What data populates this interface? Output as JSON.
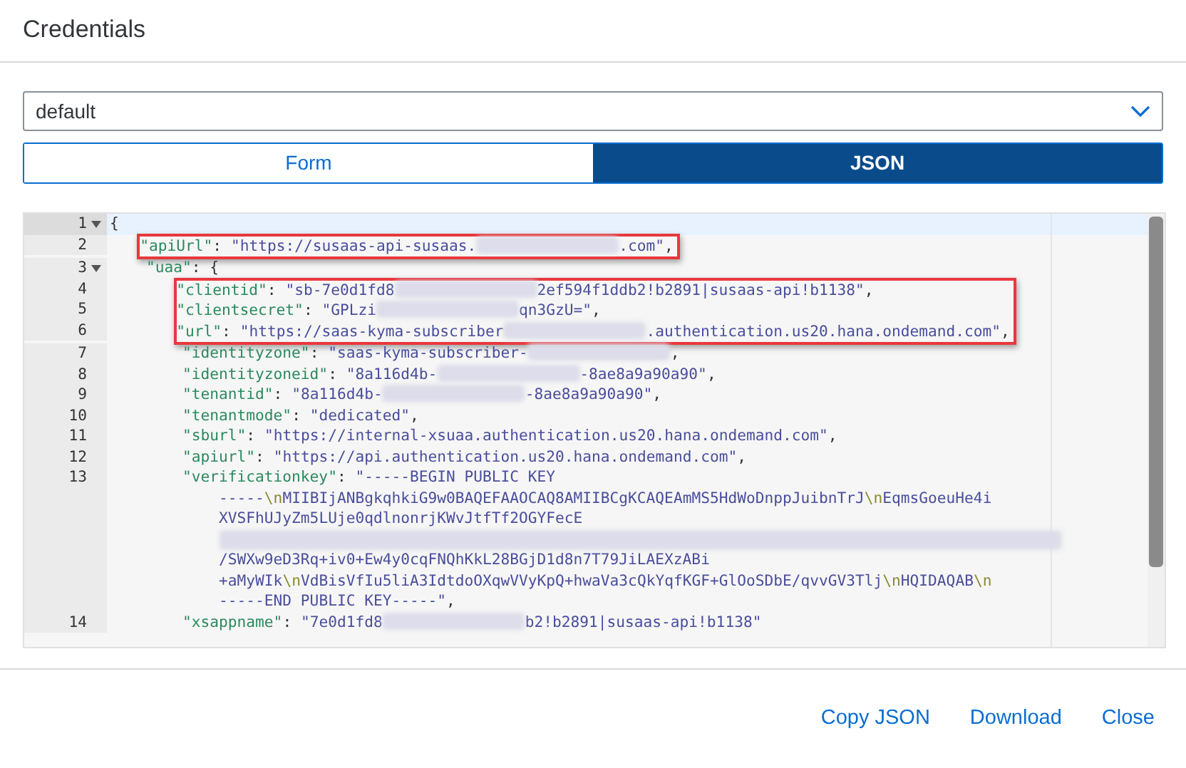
{
  "dialog": {
    "title": "Credentials"
  },
  "select": {
    "value": "default"
  },
  "view_tabs": [
    {
      "label": "Form",
      "selected": false
    },
    {
      "label": "JSON",
      "selected": true
    }
  ],
  "editor": {
    "lines": [
      {
        "number": "1",
        "active": true,
        "boxed": false,
        "segments": [
          {
            "kind": "punct",
            "text": "{"
          }
        ],
        "children": [
          {
            "number": "2",
            "active": false,
            "boxed": true,
            "segments": [
              {
                "kind": "key",
                "text": "\"apiUrl\""
              },
              {
                "kind": "punct",
                "text": ":"
              },
              {
                "kind": "str",
                "text": "\"https://susaas-api-susaas."
              },
              {
                "kind": "blur"
              },
              {
                "kind": "str",
                "text": ".com\""
              },
              {
                "kind": "punct",
                "text": ","
              }
            ]
          },
          {
            "number": "3",
            "active": false,
            "boxed": false,
            "segments": [
              {
                "kind": "key",
                "text": "\"uaa\""
              },
              {
                "kind": "punct",
                "text": ": {"
              }
            ],
            "children": [
              {
                "number": "4",
                "active": false,
                "boxed": true,
                "segments": [
                  {
                    "kind": "key",
                    "text": "\"clientid\""
                  },
                  {
                    "kind": "punct",
                    "text": ":"
                  },
                  {
                    "kind": "str",
                    "text": "\"sb-7e0d1fd8"
                  },
                  {
                    "kind": "blur"
                  },
                  {
                    "kind": "str",
                    "text": "2ef594f1ddb2!b2891|susaas-api!b1138\""
                  },
                  {
                    "kind": "punct",
                    "text": ","
                  }
                ]
              },
              {
                "number": "5",
                "active": false,
                "boxed": true,
                "segments": [
                  {
                    "kind": "key",
                    "text": "\"clientsecret\""
                  },
                  {
                    "kind": "punct",
                    "text": ":"
                  },
                  {
                    "kind": "str",
                    "text": "\"GPLzi"
                  },
                  {
                    "kind": "blur"
                  },
                  {
                    "kind": "str",
                    "text": "qn3GzU=\""
                  },
                  {
                    "kind": "punct",
                    "text": ","
                  }
                ]
              },
              {
                "number": "6",
                "active": false,
                "boxed": true,
                "segments": [
                  {
                    "kind": "key",
                    "text": "\"url\""
                  },
                  {
                    "kind": "punct",
                    "text": ":"
                  },
                  {
                    "kind": "str",
                    "text": "\"https://saas-kyma-subscriber"
                  },
                  {
                    "kind": "blur"
                  },
                  {
                    "kind": "str",
                    "text": ".authentication.us20.hana.ondemand.com\""
                  },
                  {
                    "kind": "punct",
                    "text": ","
                  }
                ]
              },
              {
                "number": "7",
                "active": false,
                "boxed": false,
                "segments": [
                  {
                    "kind": "key",
                    "text": "\"identityzone\""
                  },
                  {
                    "kind": "punct",
                    "text": ":"
                  },
                  {
                    "kind": "str",
                    "text": "\"saas-kyma-subscriber-"
                  },
                  {
                    "kind": "blur"
                  },
                  {
                    "kind": "punct",
                    "text": ","
                  }
                ]
              },
              {
                "number": "8",
                "active": false,
                "boxed": false,
                "segments": [
                  {
                    "kind": "key",
                    "text": "\"identityzoneid\""
                  },
                  {
                    "kind": "punct",
                    "text": ":"
                  },
                  {
                    "kind": "str",
                    "text": "\"8a116d4b-"
                  },
                  {
                    "kind": "blur"
                  },
                  {
                    "kind": "str",
                    "text": "-8ae8a9a90a90\""
                  },
                  {
                    "kind": "punct",
                    "text": ","
                  }
                ]
              },
              {
                "number": "9",
                "active": false,
                "boxed": false,
                "segments": [
                  {
                    "kind": "key",
                    "text": "\"tenantid\""
                  },
                  {
                    "kind": "punct",
                    "text": ":"
                  },
                  {
                    "kind": "str",
                    "text": "\"8a116d4b-"
                  },
                  {
                    "kind": "blur"
                  },
                  {
                    "kind": "str",
                    "text": "-8ae8a9a90a90\""
                  },
                  {
                    "kind": "punct",
                    "text": ","
                  }
                ]
              },
              {
                "number": "10",
                "active": false,
                "boxed": false,
                "segments": [
                  {
                    "kind": "key",
                    "text": "\"tenantmode\""
                  },
                  {
                    "kind": "punct",
                    "text": ":"
                  },
                  {
                    "kind": "str",
                    "text": "\"dedicated\""
                  },
                  {
                    "kind": "punct",
                    "text": ","
                  }
                ]
              },
              {
                "number": "11",
                "active": false,
                "boxed": false,
                "segments": [
                  {
                    "kind": "key",
                    "text": "\"sburl\""
                  },
                  {
                    "kind": "punct",
                    "text": ":"
                  },
                  {
                    "kind": "str",
                    "text": "\"https://internal-xsuaa.authentication.us20.hana.ondemand.com\""
                  },
                  {
                    "kind": "punct",
                    "text": ","
                  }
                ]
              },
              {
                "number": "12",
                "active": false,
                "boxed": false,
                "segments": [
                  {
                    "kind": "key",
                    "text": "\"apiurl\""
                  },
                  {
                    "kind": "punct",
                    "text": ":"
                  },
                  {
                    "kind": "str",
                    "text": "\"https://api.authentication.us20.hana.ondemand.com\""
                  },
                  {
                    "kind": "punct",
                    "text": ","
                  }
                ]
              },
              {
                "number": "13",
                "active": false,
                "boxed": false,
                "segments": [
                  {
                    "kind": "key",
                    "text": "\"verificationkey\""
                  },
                  {
                    "kind": "punct",
                    "text": ":"
                  },
                  {
                    "kind": "str",
                    "text": "\"-----BEGIN PUBLIC KEY"
                  }
                ],
                "wrapped": [
                  [
                    {
                      "kind": "str",
                      "text": "-----"
                    },
                    {
                      "kind": "esc",
                      "text": "\\n"
                    },
                    {
                      "kind": "str",
                      "text": "MIIBIjANBgkqhkiG9w0BAQEFAAOCAQ8AMIIBCgKCAQEAmMS5HdWoDnppJuibnTrJ"
                    },
                    {
                      "kind": "esc",
                      "text": "\\n"
                    },
                    {
                      "kind": "str",
                      "text": "EqmsGoeuHe4i"
                    }
                  ],
                  [
                    {
                      "kind": "str",
                      "text": "XVSFhUJyZm5LUje0qdlnonrjKWvJtfTf2OGYFecE"
                    }
                  ],
                  [
                    {
                      "kind": "blur"
                    }
                  ],
                  [
                    {
                      "kind": "str",
                      "text": "/SWXw9eD3Rq+iv0+Ew4y0cqFNQhKkL28BGjD1d8n7T79JiLAEXzABi"
                    }
                  ],
                  [
                    {
                      "kind": "str",
                      "text": "+aMyWIk"
                    },
                    {
                      "kind": "esc",
                      "text": "\\n"
                    },
                    {
                      "kind": "str",
                      "text": "VdBisVfIu5liA3IdtdoOXqwVVyKpQ+hwaVa3cQkYqfKGF+GlOoSDbE/qvvGV3Tlj"
                    },
                    {
                      "kind": "esc",
                      "text": "\\n"
                    },
                    {
                      "kind": "str",
                      "text": "HQIDAQAB"
                    },
                    {
                      "kind": "esc",
                      "text": "\\n"
                    }
                  ],
                  [
                    {
                      "kind": "str",
                      "text": "-----END PUBLIC KEY-----\""
                    },
                    {
                      "kind": "punct",
                      "text": ","
                    }
                  ]
                ]
              },
              {
                "number": "14",
                "active": false,
                "boxed": false,
                "segments": [
                  {
                    "kind": "key",
                    "text": "\"xsappname\""
                  },
                  {
                    "kind": "punct",
                    "text": ":"
                  },
                  {
                    "kind": "str",
                    "text": "\"7e0d1fd8"
                  },
                  {
                    "kind": "blur"
                  },
                  {
                    "kind": "str",
                    "text": "b2!b2891|susaas-api!b1138\""
                  }
                ]
              }
            ]
          }
        ]
      }
    ]
  },
  "footer_buttons": [
    "Copy JSON",
    "Download",
    "Close"
  ]
}
